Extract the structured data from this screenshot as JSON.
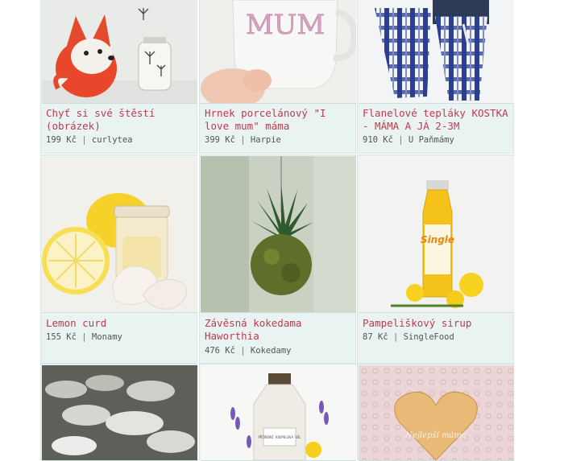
{
  "colors": {
    "title": "#c0394f",
    "meta": "#555555",
    "card_bg": "#e8f3f2"
  },
  "products": [
    {
      "title": "Chyť si své štěstí (obrázek)",
      "price": "199 Kč",
      "seller": "curlytea",
      "image": "fox-illustration-image"
    },
    {
      "title": "Hrnek porcelánový \"I love mum\" máma",
      "price": "399 Kč",
      "seller": "Harpie",
      "image": "mum-mug-image"
    },
    {
      "title": "Flanelové tepláky KOSTKA - MÁMA A JÁ 2-3M",
      "price": "910 Kč",
      "seller": "U Paňmámy",
      "image": "plaid-pants-image"
    },
    {
      "title": "Lemon curd",
      "price": "155 Kč",
      "seller": "Monamy",
      "image": "lemon-jar-image"
    },
    {
      "title": "Závěsná kokedama Haworthia",
      "price": "476 Kč",
      "seller": "Kokedamy",
      "image": "kokedama-image"
    },
    {
      "title": "Pampeliškový sirup",
      "price": "87 Kč",
      "seller": "SingleFood",
      "image": "dandelion-syrup-image"
    },
    {
      "image": "tins-image"
    },
    {
      "image": "bath-salt-image",
      "label": "PŘÍRODNÍ KOUPELOVÁ SŮL"
    },
    {
      "image": "heart-cookie-image",
      "label": "Nejlepší máma"
    }
  ],
  "separator": "|"
}
